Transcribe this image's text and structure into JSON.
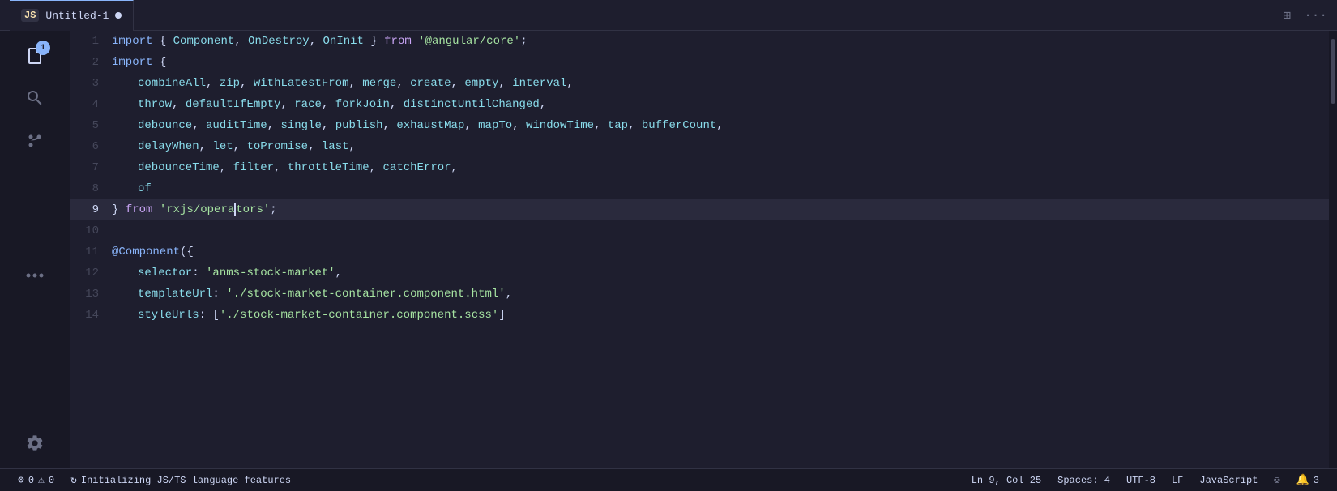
{
  "titleBar": {
    "tab": {
      "jsLabel": "JS",
      "filename": "Untitled-1",
      "modified": true
    },
    "layoutIcon": "⊞",
    "moreIcon": "···"
  },
  "activityBar": {
    "icons": [
      {
        "name": "files-icon",
        "symbol": "⧉",
        "badge": "1",
        "active": true
      },
      {
        "name": "search-icon",
        "symbol": "🔍",
        "badge": null,
        "active": false
      },
      {
        "name": "source-control-icon",
        "symbol": "⑂",
        "badge": null,
        "active": false
      },
      {
        "name": "more-icon",
        "symbol": "···",
        "badge": null,
        "active": false
      }
    ],
    "bottomIcons": [
      {
        "name": "settings-icon",
        "symbol": "⚙",
        "badge": null
      }
    ]
  },
  "code": {
    "lines": [
      {
        "num": 1,
        "content": "import { Component, OnDestroy, OnInit } from '@angular/core';",
        "active": false
      },
      {
        "num": 2,
        "content": "import {",
        "active": false
      },
      {
        "num": 3,
        "content": "    combineAll, zip, withLatestFrom, merge, create, empty, interval,",
        "active": false
      },
      {
        "num": 4,
        "content": "    throw, defaultIfEmpty, race, forkJoin, distinctUntilChanged,",
        "active": false
      },
      {
        "num": 5,
        "content": "    debounce, auditTime, single, publish, exhaustMap, mapTo, windowTime, tap, bufferCount,",
        "active": false
      },
      {
        "num": 6,
        "content": "    delayWhen, let, toPromise, last,",
        "active": false
      },
      {
        "num": 7,
        "content": "    debounceTime, filter, throttleTime, catchError,",
        "active": false
      },
      {
        "num": 8,
        "content": "    of",
        "active": false
      },
      {
        "num": 9,
        "content": "} from 'rxjs/operators';",
        "active": true
      },
      {
        "num": 10,
        "content": "",
        "active": false
      },
      {
        "num": 11,
        "content": "@Component({",
        "active": false
      },
      {
        "num": 12,
        "content": "    selector: 'anms-stock-market',",
        "active": false
      },
      {
        "num": 13,
        "content": "    templateUrl: './stock-market-container.component.html',",
        "active": false
      },
      {
        "num": 14,
        "content": "    styleUrls: ['./stock-market-container.component.scss']",
        "active": false
      }
    ]
  },
  "statusBar": {
    "errorCount": "0",
    "warningCount": "0",
    "syncLabel": "Initializing JS/TS language features",
    "cursorPos": "Ln 9, Col 25",
    "spaces": "Spaces: 4",
    "encoding": "UTF-8",
    "lineEnding": "LF",
    "language": "JavaScript",
    "smiley": "☺",
    "notifications": "3"
  }
}
